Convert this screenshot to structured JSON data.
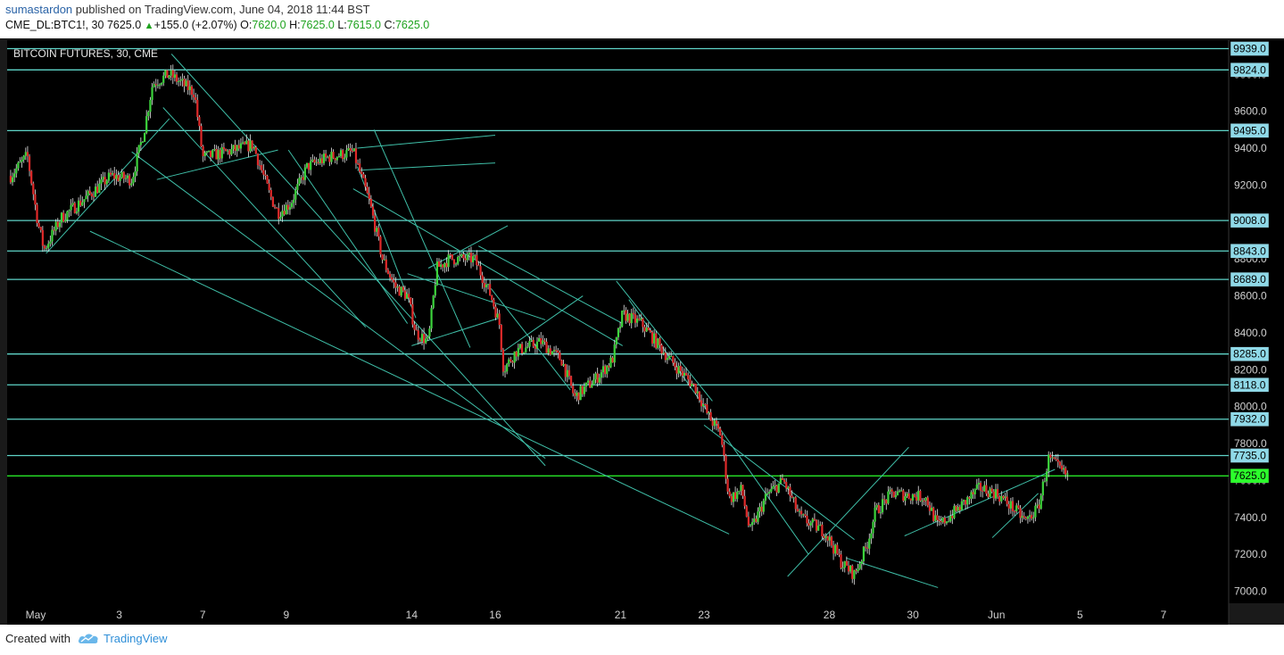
{
  "header": {
    "author": "sumastardon",
    "published_text": " published on TradingView.com, June 04, 2018 11:44 BST",
    "symbol_interval": "CME_DL:BTC1!, 30",
    "last": "7625.0",
    "change": "+155.0 (+2.07%)",
    "o_label": "O:",
    "o_value": "7620.0",
    "h_label": "H:",
    "h_value": "7625.0",
    "l_label": "L:",
    "l_value": "7615.0",
    "c_label": "C:",
    "c_value": "7625.0"
  },
  "footer": {
    "created_with": "Created with",
    "brand": "TradingView",
    "logo_icon": "tradingview-cloud-icon"
  },
  "colors": {
    "background": "#000000",
    "level_line": "#5fd4c8",
    "trend_line": "#3fbfa8",
    "up": "#3cd43c",
    "down": "#e02a2a",
    "wick": "#e8e8e8",
    "current": "#2cff2c",
    "label_bg": "#8fd9e8",
    "axis_text": "#d0d0d0"
  },
  "chart_data": {
    "type": "candlestick",
    "title": "BITCOIN FUTURES, 30, CME",
    "ylim": [
      6935,
      9985
    ],
    "y_ticks": [
      7000,
      7200,
      7400,
      7600,
      7800,
      8000,
      8200,
      8400,
      8600,
      8800,
      9000,
      9200,
      9400,
      9600,
      9800
    ],
    "y_tick_labels": [
      "7000.0",
      "7200.0",
      "7400.0",
      "7600.0",
      "7800.0",
      "8000.0",
      "8200.0",
      "8400.0",
      "8600.0",
      "8800.0",
      "9000.0",
      "9200.0",
      "9400.0",
      "9600.0",
      "9800.0"
    ],
    "x_ticks": [
      {
        "label": "May",
        "t": 0
      },
      {
        "label": "3",
        "t": 2
      },
      {
        "label": "7",
        "t": 4
      },
      {
        "label": "9",
        "t": 6
      },
      {
        "label": "14",
        "t": 9
      },
      {
        "label": "16",
        "t": 11
      },
      {
        "label": "21",
        "t": 14
      },
      {
        "label": "23",
        "t": 16
      },
      {
        "label": "28",
        "t": 19
      },
      {
        "label": "30",
        "t": 21
      },
      {
        "label": "Jun",
        "t": 23
      },
      {
        "label": "5",
        "t": 25
      },
      {
        "label": "7",
        "t": 27
      }
    ],
    "levels": [
      {
        "value": 9939,
        "label": "9939.0"
      },
      {
        "value": 9824,
        "label": "9824.0"
      },
      {
        "value": 9495,
        "label": "9495.0"
      },
      {
        "value": 9008,
        "label": "9008.0"
      },
      {
        "value": 8843,
        "label": "8843.0"
      },
      {
        "value": 8689,
        "label": "8689.0"
      },
      {
        "value": 8285,
        "label": "8285.0"
      },
      {
        "value": 8118,
        "label": "8118.0"
      },
      {
        "value": 7932,
        "label": "7932.0"
      },
      {
        "value": 7735,
        "label": "7735.0"
      },
      {
        "value": 7625,
        "label": "7625.0",
        "current": true
      }
    ],
    "price_path": [
      [
        -0.6,
        9250
      ],
      [
        -0.2,
        9360
      ],
      [
        0.05,
        9000
      ],
      [
        0.2,
        8850
      ],
      [
        0.6,
        9020
      ],
      [
        1.3,
        9150
      ],
      [
        1.8,
        9250
      ],
      [
        2.3,
        9230
      ],
      [
        2.6,
        9500
      ],
      [
        2.8,
        9750
      ],
      [
        3.2,
        9800
      ],
      [
        3.8,
        9700
      ],
      [
        4.0,
        9350
      ],
      [
        4.6,
        9380
      ],
      [
        5.2,
        9420
      ],
      [
        5.6,
        9150
      ],
      [
        5.8,
        9050
      ],
      [
        6.1,
        9100
      ],
      [
        6.5,
        9300
      ],
      [
        7.0,
        9350
      ],
      [
        7.6,
        9380
      ],
      [
        8.0,
        9100
      ],
      [
        8.3,
        8800
      ],
      [
        8.6,
        8650
      ],
      [
        8.9,
        8600
      ],
      [
        9.1,
        8400
      ],
      [
        9.4,
        8350
      ],
      [
        9.6,
        8750
      ],
      [
        9.9,
        8800
      ],
      [
        10.5,
        8800
      ],
      [
        10.9,
        8600
      ],
      [
        11.1,
        8450
      ],
      [
        11.2,
        8200
      ],
      [
        11.5,
        8300
      ],
      [
        12.1,
        8350
      ],
      [
        12.6,
        8250
      ],
      [
        12.9,
        8050
      ],
      [
        13.4,
        8150
      ],
      [
        13.8,
        8250
      ],
      [
        14.05,
        8500
      ],
      [
        14.5,
        8450
      ],
      [
        15.2,
        8250
      ],
      [
        15.8,
        8100
      ],
      [
        16.1,
        7950
      ],
      [
        16.4,
        7850
      ],
      [
        16.6,
        7500
      ],
      [
        16.9,
        7550
      ],
      [
        17.1,
        7320
      ],
      [
        17.5,
        7520
      ],
      [
        17.9,
        7600
      ],
      [
        18.3,
        7400
      ],
      [
        18.9,
        7320
      ],
      [
        19.3,
        7150
      ],
      [
        19.6,
        7090
      ],
      [
        19.9,
        7250
      ],
      [
        20.1,
        7430
      ],
      [
        20.5,
        7530
      ],
      [
        21.3,
        7510
      ],
      [
        21.6,
        7350
      ],
      [
        22.1,
        7450
      ],
      [
        22.6,
        7560
      ],
      [
        23.0,
        7530
      ],
      [
        23.4,
        7450
      ],
      [
        23.7,
        7380
      ],
      [
        24.0,
        7450
      ],
      [
        24.25,
        7720
      ],
      [
        24.6,
        7640
      ],
      [
        24.7,
        7625
      ]
    ]
  }
}
